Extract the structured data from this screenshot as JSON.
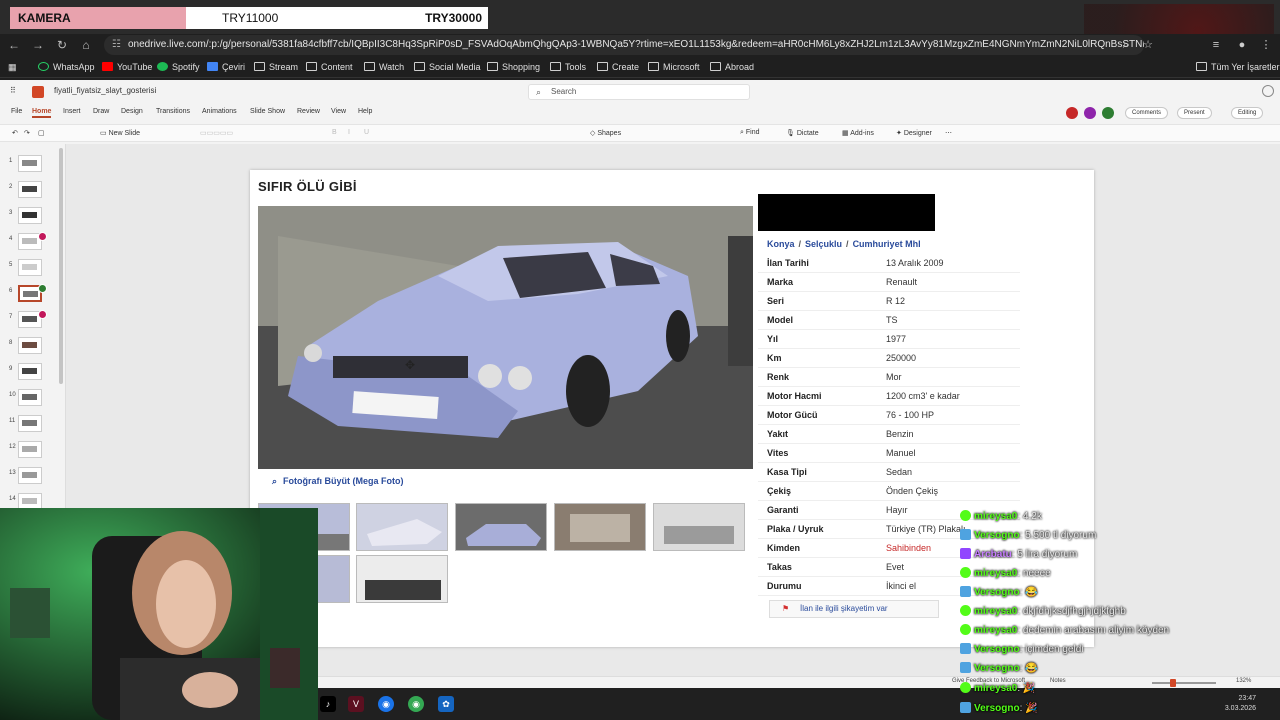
{
  "overlay": {
    "camera_label": "KAMERA",
    "goal_current": "TRY11000",
    "goal_target": "TRY30000"
  },
  "browser": {
    "url": "onedrive.live.com/:p:/g/personal/5381fa84cfbff7cb/IQBpII3C8Hq3SpRiP0sD_FSVAdOqAbmQhgQAp3-1WBNQa5Y?rtime=xEO1L1153kg&redeem=aHR0cHM6Ly8xZHJ2Lm1zL3AvYy81MzgxZmE4NGNmYmZmN2NiL0lRQnBsSTNDOEhxM1N...",
    "bookmarks": [
      "WhatsApp",
      "YouTube",
      "Spotify",
      "Çeviri",
      "Stream",
      "Content",
      "Watch",
      "Social Media",
      "Shopping",
      "Tools",
      "Create",
      "Microsoft",
      "Abroad"
    ],
    "bookmarks_all": "Tüm Yer İşaretleri"
  },
  "office": {
    "doc_title": "fiyatli_fiyatsiz_slayt_gosterisi",
    "search_placeholder": "Search",
    "menu": [
      "File",
      "Home",
      "Insert",
      "Draw",
      "Design",
      "Transitions",
      "Animations",
      "Slide Show",
      "Review",
      "View",
      "Help"
    ],
    "buttons": {
      "comments": "Comments",
      "present": "Present",
      "editing": "Editing"
    },
    "toolbar": {
      "new_slide": "New Slide",
      "shapes": "Shapes",
      "find": "Find",
      "dictate": "Dictate",
      "addins": "Add-ins",
      "designer": "Designer"
    },
    "slide_numbers": [
      "1",
      "2",
      "3",
      "4",
      "5",
      "6",
      "7",
      "8",
      "9",
      "10",
      "11",
      "12",
      "13",
      "14"
    ],
    "status": {
      "feedback": "Give Feedback to Microsoft",
      "notes": "Notes",
      "zoom": "132%"
    }
  },
  "slide": {
    "title": "SIFIR ÖLÜ GİBİ",
    "photo_link": "Fotoğrafı Büyüt (Mega Foto)",
    "breadcrumb": [
      "Konya",
      "Selçuklu",
      "Cumhuriyet Mhl"
    ],
    "specs": [
      {
        "k": "İlan Tarihi",
        "v": "13 Aralık 2009"
      },
      {
        "k": "Marka",
        "v": "Renault"
      },
      {
        "k": "Seri",
        "v": "R 12"
      },
      {
        "k": "Model",
        "v": "TS"
      },
      {
        "k": "Yıl",
        "v": "1977"
      },
      {
        "k": "Km",
        "v": "250000"
      },
      {
        "k": "Renk",
        "v": "Mor"
      },
      {
        "k": "Motor Hacmi",
        "v": "1200 cm3' e kadar"
      },
      {
        "k": "Motor Gücü",
        "v": "76 - 100 HP"
      },
      {
        "k": "Yakıt",
        "v": "Benzin"
      },
      {
        "k": "Vites",
        "v": "Manuel"
      },
      {
        "k": "Kasa Tipi",
        "v": "Sedan"
      },
      {
        "k": "Çekiş",
        "v": "Önden Çekiş"
      },
      {
        "k": "Garanti",
        "v": "Hayır"
      },
      {
        "k": "Plaka / Uyruk",
        "v": "Türkiye (TR) Plakalı"
      },
      {
        "k": "Kimden",
        "v": "Sahibinden"
      },
      {
        "k": "Takas",
        "v": "Evet"
      },
      {
        "k": "Durumu",
        "v": "İkinci el"
      }
    ],
    "report_button": "İlan ile ilgili şikayetim var"
  },
  "chat": [
    {
      "user": "mireysa0",
      "text": ": 4.2k",
      "color": "#53fc18",
      "platform": "tw"
    },
    {
      "user": "Versogno",
      "text": ": 5.500 tl diyorum",
      "color": "#53fc18",
      "platform": "kick"
    },
    {
      "user": "Arcbatu",
      "text": ": 5 lira diyorum",
      "color": "#c77dff",
      "platform": "p"
    },
    {
      "user": "mireysa0",
      "text": ": neeee",
      "color": "#53fc18",
      "platform": "tw"
    },
    {
      "user": "Versogno",
      "text": ": 😂",
      "color": "#53fc18",
      "platform": "kick"
    },
    {
      "user": "mireysa0",
      "text": ": dkjfdhjksdjfhgjhjdjkfghb",
      "color": "#53fc18",
      "platform": "tw"
    },
    {
      "user": "mireysa0",
      "text": ": dedemin arabasını aliyim köyden",
      "color": "#53fc18",
      "platform": "tw"
    },
    {
      "user": "Versogno",
      "text": ": içimden geldi",
      "color": "#53fc18",
      "platform": "kick"
    },
    {
      "user": "Versogno",
      "text": ": 😂",
      "color": "#53fc18",
      "platform": "kick"
    },
    {
      "user": "mireysa0",
      "text": ": 🎉",
      "color": "#53fc18",
      "platform": "tw"
    },
    {
      "user": "Versogno",
      "text": ": 🎉",
      "color": "#53fc18",
      "platform": "kick"
    }
  ],
  "taskbar": {
    "time": "23:47",
    "date": "3.03.2026"
  }
}
